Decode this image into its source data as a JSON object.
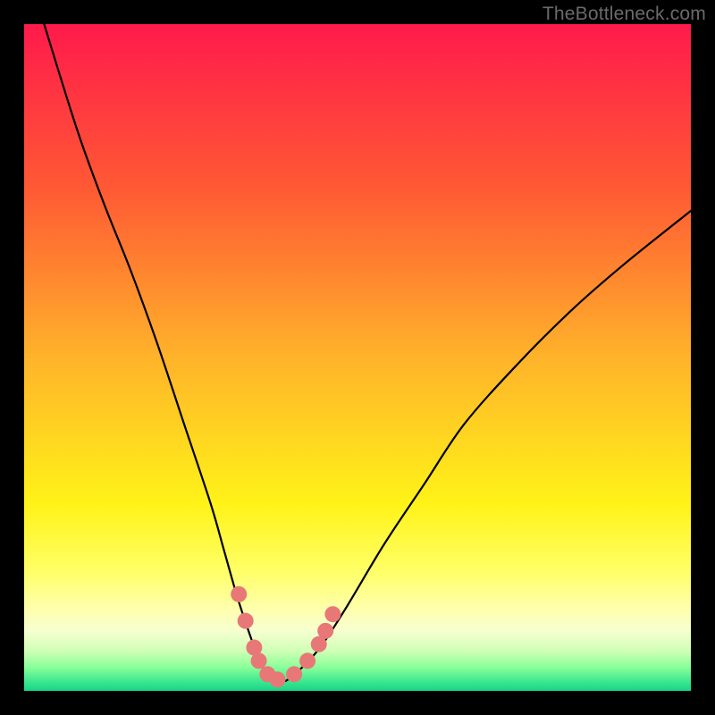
{
  "watermark": "TheBottleneck.com",
  "chart_data": {
    "type": "line",
    "title": "",
    "xlabel": "",
    "ylabel": "",
    "xlim": [
      0,
      100
    ],
    "ylim": [
      0,
      100
    ],
    "grid": false,
    "legend": false,
    "annotations": [],
    "background_gradient": {
      "stops": [
        {
          "offset": 0.0,
          "color": "#ff1a4b"
        },
        {
          "offset": 0.25,
          "color": "#ff5a34"
        },
        {
          "offset": 0.5,
          "color": "#ffb32a"
        },
        {
          "offset": 0.72,
          "color": "#fff318"
        },
        {
          "offset": 0.82,
          "color": "#ffff66"
        },
        {
          "offset": 0.88,
          "color": "#ffffb0"
        },
        {
          "offset": 0.91,
          "color": "#f6ffd0"
        },
        {
          "offset": 0.94,
          "color": "#d0ffb6"
        },
        {
          "offset": 0.965,
          "color": "#88ff99"
        },
        {
          "offset": 0.985,
          "color": "#40e890"
        },
        {
          "offset": 1.0,
          "color": "#17d488"
        }
      ]
    },
    "series": [
      {
        "name": "bottleneck-curve",
        "color": "#000000",
        "x": [
          3,
          8,
          12,
          16,
          20,
          24,
          28,
          30,
          32,
          34,
          35.5,
          37,
          38.5,
          40,
          44,
          48,
          54,
          60,
          66,
          74,
          82,
          90,
          100
        ],
        "y": [
          100,
          84,
          73,
          63,
          52,
          40,
          28,
          21,
          14,
          8,
          4,
          2,
          1.5,
          2,
          6,
          12,
          22,
          31,
          40,
          49,
          57,
          64,
          72
        ]
      }
    ],
    "markers": {
      "name": "highlight-dots",
      "color": "#e87878",
      "points": [
        {
          "x": 32.2,
          "y": 14.5
        },
        {
          "x": 33.2,
          "y": 10.5
        },
        {
          "x": 34.5,
          "y": 6.5
        },
        {
          "x": 35.2,
          "y": 4.5
        },
        {
          "x": 36.5,
          "y": 2.5
        },
        {
          "x": 38.0,
          "y": 1.7
        },
        {
          "x": 40.5,
          "y": 2.5
        },
        {
          "x": 42.5,
          "y": 4.5
        },
        {
          "x": 44.2,
          "y": 7.0
        },
        {
          "x": 45.2,
          "y": 9.0
        },
        {
          "x": 46.3,
          "y": 11.5
        }
      ]
    }
  }
}
